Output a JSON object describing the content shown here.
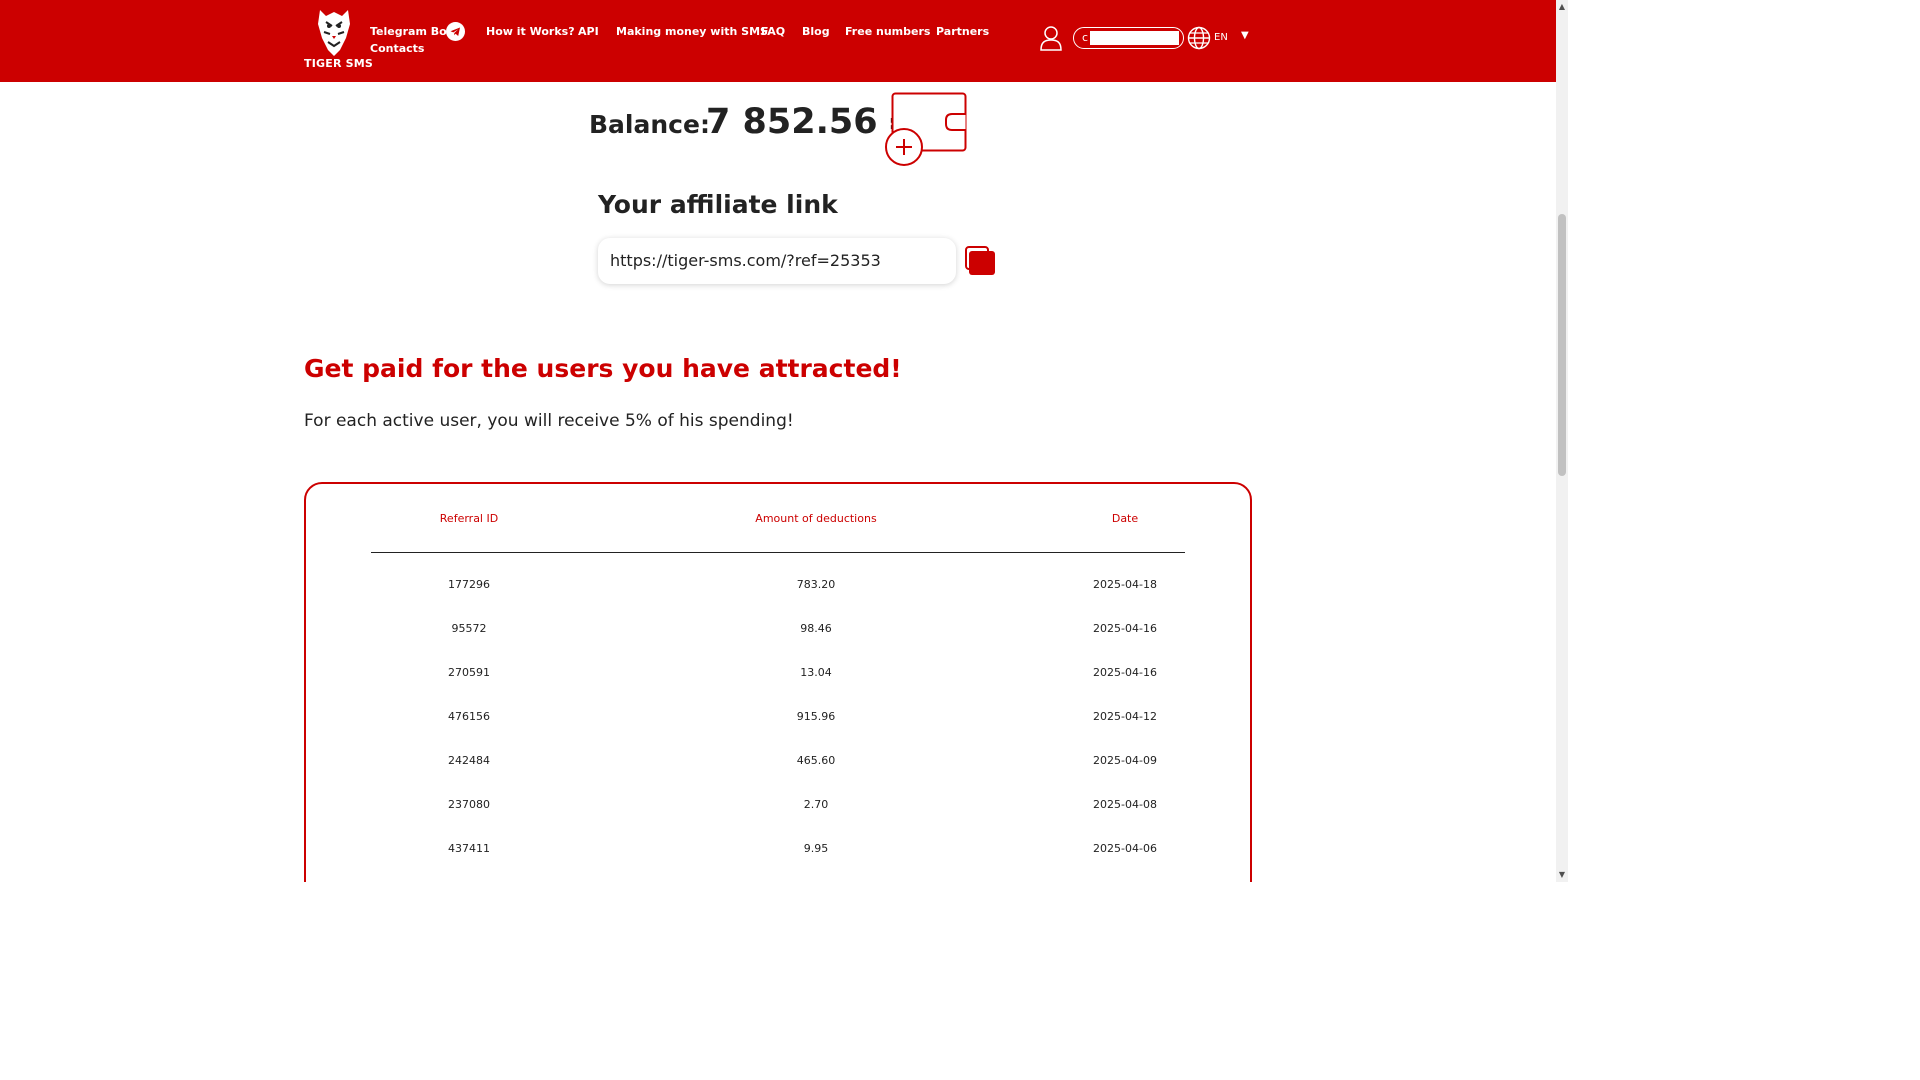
{
  "header": {
    "logo_text": "TIGER SMS",
    "nav": {
      "telegram_bot": "Telegram Bot",
      "contacts": "Contacts",
      "how_it_works": "How it Works?",
      "api": "API",
      "making_money": "Making money with SMS",
      "faq": "FAQ",
      "blog": "Blog",
      "free_numbers": "Free numbers",
      "partners": "Partners"
    },
    "email_first_char": "c",
    "language": "EN",
    "colors": {
      "brand": "#cc0000"
    }
  },
  "balance": {
    "label": "Balance:",
    "value": "7 852.56 ₽"
  },
  "affiliate": {
    "title": "Your affiliate link",
    "link": "https://tiger-sms.com/?ref=25353"
  },
  "promo": {
    "headline": "Get paid for the users you have attracted!",
    "subline": "For each active user, you will receive 5% of his spending!"
  },
  "table": {
    "headers": [
      "Referral ID",
      "Amount of deductions",
      "Date"
    ],
    "rows": [
      [
        "177296",
        "783.20",
        "2025-04-18"
      ],
      [
        "95572",
        "98.46",
        "2025-04-16"
      ],
      [
        "270591",
        "13.04",
        "2025-04-16"
      ],
      [
        "476156",
        "915.96",
        "2025-04-12"
      ],
      [
        "242484",
        "465.60",
        "2025-04-09"
      ],
      [
        "237080",
        "2.70",
        "2025-04-08"
      ],
      [
        "437411",
        "9.95",
        "2025-04-06"
      ]
    ]
  }
}
